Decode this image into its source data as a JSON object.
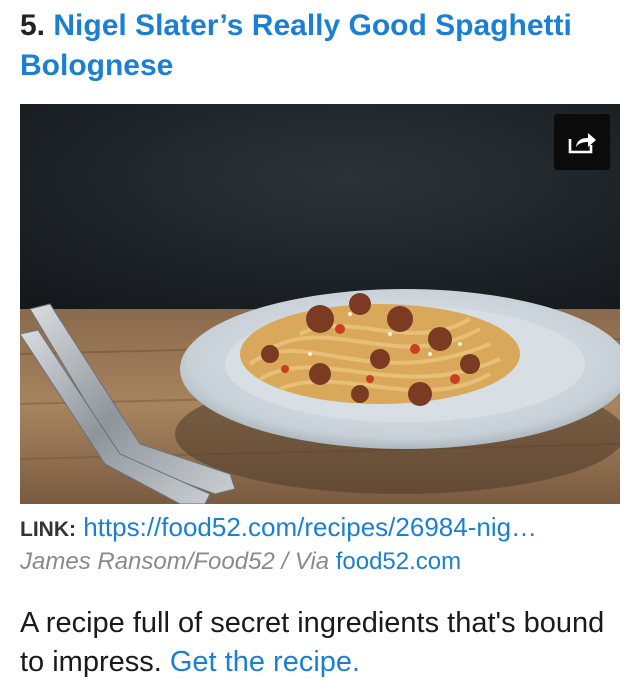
{
  "item": {
    "number": "5.",
    "title": "Nigel Slater’s Really Good Spaghetti Bolognese"
  },
  "image": {
    "share_icon": "share-arrow-icon",
    "accent_color": "#1b7fd4"
  },
  "link": {
    "label": "LINK:",
    "url": "https://food52.com/recipes/26984-nig…"
  },
  "credit": {
    "text": "James Ransom/Food52 / Via ",
    "source": "food52.com"
  },
  "description": {
    "text": "A recipe full of secret ingredients that's bound to impress. ",
    "link_text": "Get the recipe."
  }
}
